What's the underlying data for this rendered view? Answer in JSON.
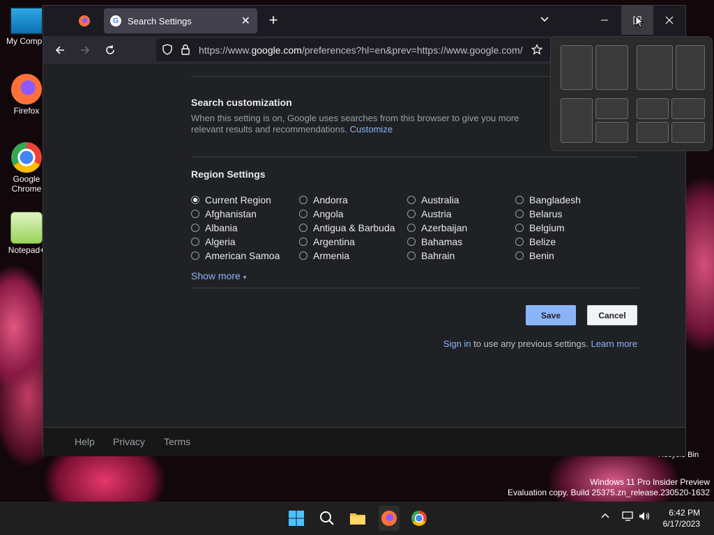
{
  "desktop": {
    "icons": [
      {
        "label": "My Compu"
      },
      {
        "label": "Firefox"
      },
      {
        "label": "Google Chrome"
      },
      {
        "label": "Notepad+"
      }
    ],
    "watermark_line1": "Windows 11 Pro Insider Preview",
    "watermark_line2": "Evaluation copy. Build 25375.zn_release.230520-1632",
    "recycle_bin": "Recycle Bin"
  },
  "browser": {
    "tab_title": "Search Settings",
    "url_prefix": "https://www.",
    "url_domain": "google.com",
    "url_rest": "/preferences?hl=en&prev=https://www.google.com/"
  },
  "page": {
    "search_customization": {
      "heading": "Search customization",
      "description": "When this setting is on, Google uses searches from this browser to give you more relevant results and recommendations.",
      "link": "Customize"
    },
    "region": {
      "heading": "Region Settings",
      "columns": [
        [
          "Current Region",
          "Afghanistan",
          "Albania",
          "Algeria",
          "American Samoa"
        ],
        [
          "Andorra",
          "Angola",
          "Antigua & Barbuda",
          "Argentina",
          "Armenia"
        ],
        [
          "Australia",
          "Austria",
          "Azerbaijan",
          "Bahamas",
          "Bahrain"
        ],
        [
          "Bangladesh",
          "Belarus",
          "Belgium",
          "Belize",
          "Benin"
        ]
      ],
      "selected": "Current Region",
      "show_more": "Show more"
    },
    "save_label": "Save",
    "cancel_label": "Cancel",
    "signin_link": "Sign in",
    "signin_text": " to use any previous settings. ",
    "learn_more": "Learn more",
    "footer": {
      "help": "Help",
      "privacy": "Privacy",
      "terms": "Terms"
    }
  },
  "taskbar": {
    "time": "6:42 PM",
    "date": "6/17/2023"
  }
}
